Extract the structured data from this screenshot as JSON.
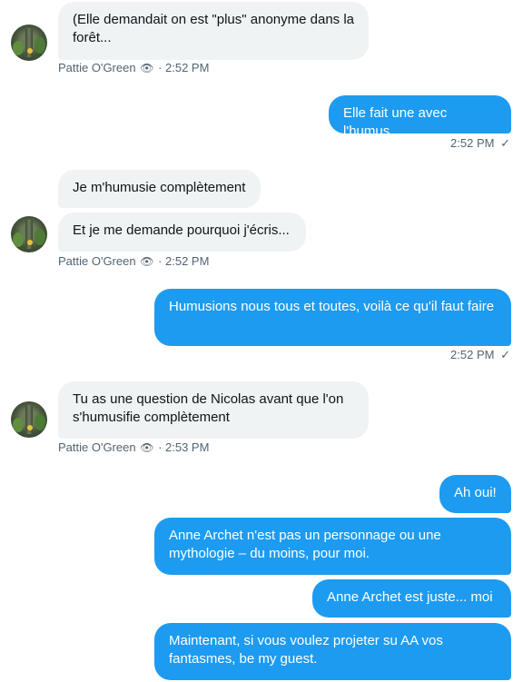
{
  "messages": {
    "m1": {
      "text": "(Elle demandait on est \"plus\" anonyme dans la forêt..."
    },
    "m1_meta": {
      "sender": "Pattie O'Green",
      "eye": "👁",
      "time": "· 2:52 PM"
    },
    "m2": {
      "text": "Elle fait une avec l'humus"
    },
    "m2_meta": {
      "time": "2:52 PM",
      "check": "✓"
    },
    "m3": {
      "text": "Je m'humusie complètement"
    },
    "m4": {
      "text": "Et je me demande pourquoi j'écris..."
    },
    "m4_meta": {
      "sender": "Pattie O'Green",
      "eye": "👁",
      "time": "· 2:52 PM"
    },
    "m5": {
      "text": "Humusions nous tous et toutes, voilà ce qu'il faut faire"
    },
    "m5_meta": {
      "time": "2:52 PM",
      "check": "✓"
    },
    "m6": {
      "text": "Tu as une question de Nicolas avant que l'on s'humusifie complètement"
    },
    "m6_meta": {
      "sender": "Pattie O'Green",
      "eye": "👁",
      "time": "· 2:53 PM"
    },
    "m7": {
      "text": "Ah oui!"
    },
    "m8": {
      "text": "Anne Archet n'est pas un personnage ou une mythologie – du moins, pour moi."
    },
    "m9": {
      "text": "Anne Archet est juste... moi"
    },
    "m10": {
      "text": "Maintenant, si vous voulez projeter su AA vos fantasmes, be my guest."
    }
  },
  "icons": {
    "avatar": "avatar-image",
    "eye": "eye-icon",
    "check": "check-icon"
  },
  "colors": {
    "outgoing_bubble": "#1d9bf0",
    "incoming_bubble": "#eff3f4",
    "meta_text": "#536471"
  }
}
